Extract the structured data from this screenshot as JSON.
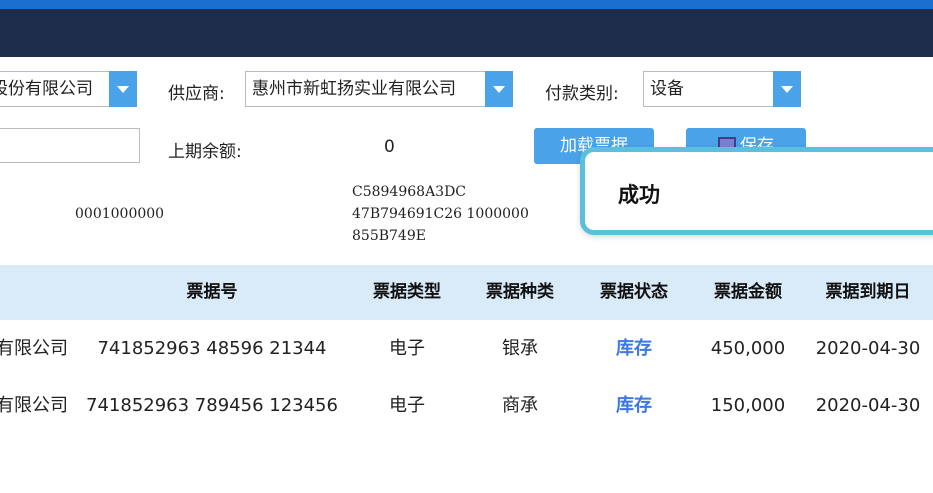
{
  "filters": {
    "company_value": "股份有限公司",
    "supplier_label": "供应商:",
    "supplier_value": "惠州市新虹扬实业有限公司",
    "payment_type_label": "付款类别:",
    "payment_type_value": "设备",
    "prev_balance_label": "上期余额:",
    "prev_balance_value": "0",
    "load_button": "加载票据",
    "save_button": "保存"
  },
  "info": {
    "account": "0001000000",
    "code_lines": [
      "C5894968A3DC",
      "47B794691C26 1000000",
      "855B749E"
    ]
  },
  "table": {
    "headers": [
      "票据号",
      "票据类型",
      "票据种类",
      "票据状态",
      "票据金额",
      "票据到期日"
    ],
    "rows": [
      {
        "company": "有限公司",
        "bill_no": "741852963 48596 21344",
        "type": "电子",
        "kind": "银承",
        "status": "库存",
        "amount": "450,000",
        "due": "2020-04-30"
      },
      {
        "company": "有限公司",
        "bill_no": "741852963 789456 123456",
        "type": "电子",
        "kind": "商承",
        "status": "库存",
        "amount": "150,000",
        "due": "2020-04-30"
      }
    ]
  },
  "toast": {
    "message": "成功"
  },
  "colors": {
    "header": "#1e2d4b",
    "accent": "#4aa3e8",
    "status": "#3f78e0",
    "toast_border": "#5bc0de"
  }
}
